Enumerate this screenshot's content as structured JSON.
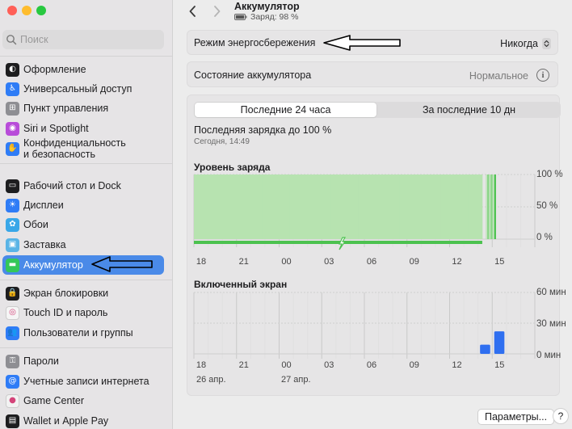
{
  "window": {
    "traffic_lights": [
      "#ff5f57",
      "#febc2e",
      "#28c840"
    ]
  },
  "sidebar": {
    "search_placeholder": "Поиск",
    "items": [
      {
        "label": "Оформление",
        "icon": "appearance-icon",
        "color": "#1d1d1f",
        "glyph": "◐"
      },
      {
        "label": "Универсальный доступ",
        "icon": "accessibility-icon",
        "color": "#2f7cf6",
        "glyph": "♿"
      },
      {
        "label": "Пункт управления",
        "icon": "control-center-icon",
        "color": "#8e8e93",
        "glyph": "⊞"
      },
      {
        "label": "Siri и Spotlight",
        "icon": "siri-icon",
        "color": "#b84bd9",
        "glyph": "◉"
      },
      {
        "label": "Конфиденциальность и безопасность",
        "label_line1": "Конфиденциальность",
        "label_line2": "и безопасность",
        "icon": "privacy-hand-icon",
        "color": "#2f7cf6",
        "glyph": "✋"
      },
      {
        "label": "Рабочий стол и Dock",
        "icon": "desktop-dock-icon",
        "color": "#1d1d1f",
        "glyph": "▭"
      },
      {
        "label": "Дисплеи",
        "icon": "displays-icon",
        "color": "#2f7cf6",
        "glyph": "☀"
      },
      {
        "label": "Обои",
        "icon": "wallpaper-icon",
        "color": "#39a7e8",
        "glyph": "✿"
      },
      {
        "label": "Заставка",
        "icon": "screensaver-icon",
        "color": "#5ab4e6",
        "glyph": "▣"
      },
      {
        "label": "Аккумулятор",
        "icon": "battery-icon",
        "color": "#34c759",
        "glyph": "▬",
        "active": true
      },
      {
        "label": "Экран блокировки",
        "icon": "lock-screen-icon",
        "color": "#1d1d1f",
        "glyph": "🔒"
      },
      {
        "label": "Touch ID и пароль",
        "icon": "touch-id-icon",
        "color": "#f5f5f5",
        "glyph": "◎"
      },
      {
        "label": "Пользователи и группы",
        "icon": "users-icon",
        "color": "#2f7cf6",
        "glyph": "👥"
      },
      {
        "label": "Пароли",
        "icon": "passwords-key-icon",
        "color": "#8e8e93",
        "glyph": "⚿"
      },
      {
        "label": "Учетные записи интернета",
        "icon": "internet-accounts-icon",
        "color": "#2f7cf6",
        "glyph": "@"
      },
      {
        "label": "Game Center",
        "icon": "game-center-icon",
        "color": "#f2f2f2",
        "glyph": "●"
      },
      {
        "label": "Wallet и Apple Pay",
        "icon": "wallet-icon",
        "color": "#1d1d1f",
        "glyph": "▤"
      }
    ]
  },
  "header": {
    "title": "Аккумулятор",
    "subtitle": "Заряд: 98 %",
    "charge_percent": 98
  },
  "low_power": {
    "label": "Режим энергосбережения",
    "value": "Никогда"
  },
  "battery_health": {
    "label": "Состояние аккумулятора",
    "value": "Нормальное"
  },
  "usage": {
    "segments": [
      "Последние 24 часа",
      "За последние 10 дн"
    ],
    "selected_segment": 0,
    "last_charge": "Последняя зарядка до 100 %",
    "last_charge_time": "Сегодня, 14:49",
    "accent_green": "#4cc24f",
    "accent_blue": "#2f6ff0"
  },
  "chart_data": [
    {
      "type": "area",
      "title": "Уровень заряда",
      "x_ticks": [
        "18",
        "21",
        "00",
        "03",
        "06",
        "09",
        "12",
        "15"
      ],
      "y_ticks": [
        "100 %",
        "50 %",
        "0 %"
      ],
      "ylim": [
        0,
        100
      ],
      "series": [
        {
          "values": [
            100,
            100,
            100,
            100,
            100,
            100,
            100,
            100,
            100,
            100,
            100,
            100,
            100,
            100,
            100,
            100,
            100,
            100,
            100,
            100,
            100
          ]
        }
      ],
      "charging_marker": "charging-bolt-icon"
    },
    {
      "type": "bar",
      "title": "Включенный экран",
      "x_ticks": [
        "18",
        "21",
        "00",
        "03",
        "06",
        "09",
        "12",
        "15"
      ],
      "date_labels": [
        "26 апр.",
        "27 апр."
      ],
      "y_ticks": [
        "60 мин",
        "30 мин",
        "0 мин"
      ],
      "ylim": [
        0,
        60
      ],
      "values": [
        0,
        0,
        0,
        0,
        0,
        0,
        0,
        0,
        0,
        0,
        0,
        0,
        0,
        0,
        0,
        0,
        0,
        0,
        0,
        0,
        9,
        22,
        0,
        0
      ],
      "unit": "мин"
    }
  ],
  "buttons": {
    "params": "Параметры...",
    "help": "?"
  }
}
